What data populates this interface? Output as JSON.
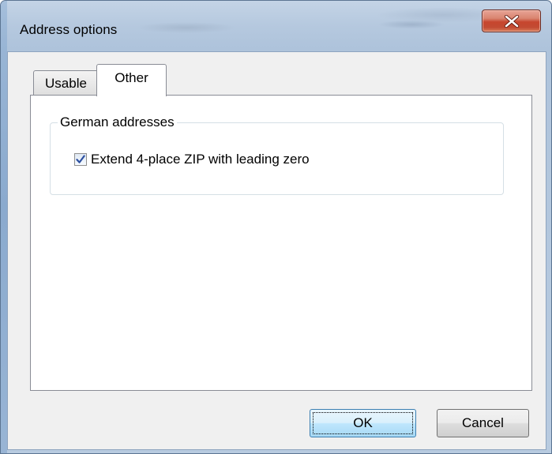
{
  "window": {
    "title": "Address options",
    "close_icon": "close-icon"
  },
  "tabs": [
    {
      "label": "Usable",
      "selected": false
    },
    {
      "label": "Other",
      "selected": true
    }
  ],
  "group": {
    "legend": "German addresses",
    "checkbox": {
      "label": "Extend 4-place ZIP with leading zero",
      "checked": true
    }
  },
  "buttons": {
    "ok": "OK",
    "cancel": "Cancel"
  },
  "colors": {
    "close_button": "#c7462e",
    "check_mark": "#2c4fa0",
    "ok_button_border": "#3c7fb1"
  }
}
